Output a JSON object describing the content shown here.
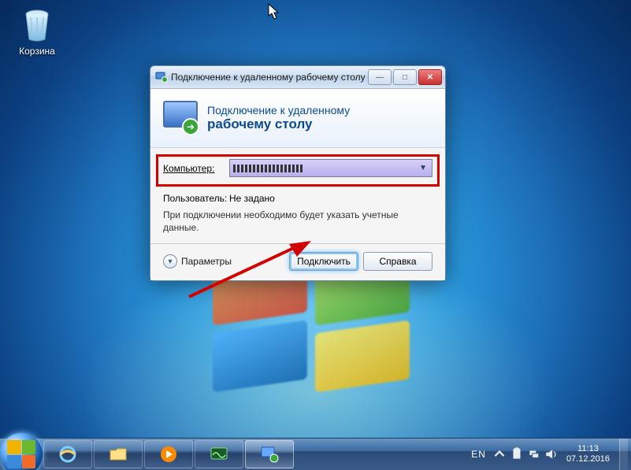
{
  "desktop": {
    "recycle_bin_label": "Корзина"
  },
  "window": {
    "title": "Подключение к удаленному рабочему столу",
    "header_line1": "Подключение к удаленному",
    "header_line2": "рабочему столу",
    "computer_label": "Компьютер:",
    "computer_value": "",
    "user_label": "Пользователь:",
    "user_value": "Не задано",
    "info_text": "При подключении необходимо будет указать учетные данные.",
    "options_label": "Параметры",
    "connect_label": "Подключить",
    "help_label": "Справка",
    "minimize": "—",
    "maximize": "□",
    "close": "✕"
  },
  "taskbar": {
    "lang": "EN",
    "time": "11:13",
    "date": "07.12.2016"
  }
}
